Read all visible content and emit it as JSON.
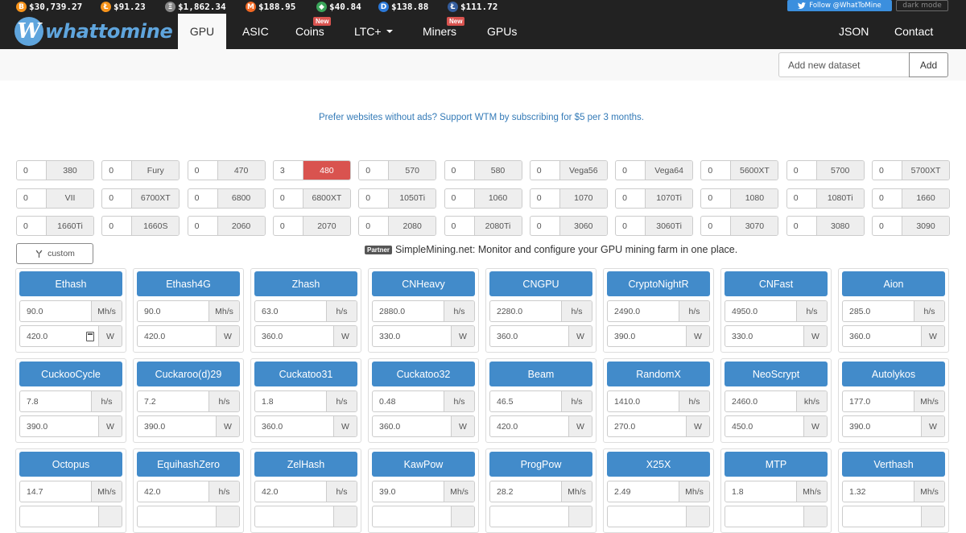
{
  "ticker": [
    {
      "symbol": "B",
      "price": "$30,739.27",
      "color": "#f7931a"
    },
    {
      "symbol": "Ł",
      "price": "$91.23",
      "color": "#f7931a"
    },
    {
      "symbol": "Ξ",
      "price": "$1,862.34",
      "color": "#888888"
    },
    {
      "symbol": "M",
      "price": "$188.95",
      "color": "#f26822"
    },
    {
      "symbol": "◆",
      "price": "$40.84",
      "color": "#3aa55a"
    },
    {
      "symbol": "D",
      "price": "$138.88",
      "color": "#2a78d8"
    },
    {
      "symbol": "Ł",
      "price": "$111.72",
      "color": "#345d9d"
    }
  ],
  "follow_label": "Follow @WhatToMine",
  "dark_mode_label": "dark mode",
  "brand": "whattomine",
  "brand_letter": "W",
  "nav": {
    "gpu": "GPU",
    "asic": "ASIC",
    "coins": "Coins",
    "ltc": "LTC+",
    "miners": "Miners",
    "gpus": "GPUs",
    "json": "JSON",
    "contact": "Contact",
    "new_badge": "New"
  },
  "dataset": {
    "placeholder": "Add new dataset",
    "add_label": "Add"
  },
  "promo": "Prefer websites without ads? Support WTM by subscribing for $5 per 3 months.",
  "gpus": [
    {
      "count": "0",
      "name": "380"
    },
    {
      "count": "0",
      "name": "Fury"
    },
    {
      "count": "0",
      "name": "470"
    },
    {
      "count": "3",
      "name": "480",
      "selected": true
    },
    {
      "count": "0",
      "name": "570"
    },
    {
      "count": "0",
      "name": "580"
    },
    {
      "count": "0",
      "name": "Vega56"
    },
    {
      "count": "0",
      "name": "Vega64"
    },
    {
      "count": "0",
      "name": "5600XT"
    },
    {
      "count": "0",
      "name": "5700"
    },
    {
      "count": "0",
      "name": "5700XT"
    },
    {
      "count": "0",
      "name": "VII"
    },
    {
      "count": "0",
      "name": "6700XT"
    },
    {
      "count": "0",
      "name": "6800"
    },
    {
      "count": "0",
      "name": "6800XT"
    },
    {
      "count": "0",
      "name": "1050Ti"
    },
    {
      "count": "0",
      "name": "1060"
    },
    {
      "count": "0",
      "name": "1070"
    },
    {
      "count": "0",
      "name": "1070Ti"
    },
    {
      "count": "0",
      "name": "1080"
    },
    {
      "count": "0",
      "name": "1080Ti"
    },
    {
      "count": "0",
      "name": "1660"
    },
    {
      "count": "0",
      "name": "1660Ti"
    },
    {
      "count": "0",
      "name": "1660S"
    },
    {
      "count": "0",
      "name": "2060"
    },
    {
      "count": "0",
      "name": "2070"
    },
    {
      "count": "0",
      "name": "2080"
    },
    {
      "count": "0",
      "name": "2080Ti"
    },
    {
      "count": "0",
      "name": "3060"
    },
    {
      "count": "0",
      "name": "3060Ti"
    },
    {
      "count": "0",
      "name": "3070"
    },
    {
      "count": "0",
      "name": "3080"
    },
    {
      "count": "0",
      "name": "3090"
    }
  ],
  "custom_label": "custom",
  "partner": {
    "badge": "Partner",
    "text": "SimpleMining.net: Monitor and configure your GPU mining farm in one place."
  },
  "algos": [
    {
      "name": "Ethash",
      "hashrate": "90.0",
      "unit": "Mh/s",
      "power": "420.0",
      "power_unit": "W"
    },
    {
      "name": "Ethash4G",
      "hashrate": "90.0",
      "unit": "Mh/s",
      "power": "420.0",
      "power_unit": "W"
    },
    {
      "name": "Zhash",
      "hashrate": "63.0",
      "unit": "h/s",
      "power": "360.0",
      "power_unit": "W"
    },
    {
      "name": "CNHeavy",
      "hashrate": "2880.0",
      "unit": "h/s",
      "power": "330.0",
      "power_unit": "W"
    },
    {
      "name": "CNGPU",
      "hashrate": "2280.0",
      "unit": "h/s",
      "power": "360.0",
      "power_unit": "W"
    },
    {
      "name": "CryptoNightR",
      "hashrate": "2490.0",
      "unit": "h/s",
      "power": "390.0",
      "power_unit": "W"
    },
    {
      "name": "CNFast",
      "hashrate": "4950.0",
      "unit": "h/s",
      "power": "330.0",
      "power_unit": "W"
    },
    {
      "name": "Aion",
      "hashrate": "285.0",
      "unit": "h/s",
      "power": "360.0",
      "power_unit": "W"
    },
    {
      "name": "CuckooCycle",
      "hashrate": "7.8",
      "unit": "h/s",
      "power": "390.0",
      "power_unit": "W"
    },
    {
      "name": "Cuckaroo(d)29",
      "hashrate": "7.2",
      "unit": "h/s",
      "power": "390.0",
      "power_unit": "W"
    },
    {
      "name": "Cuckatoo31",
      "hashrate": "1.8",
      "unit": "h/s",
      "power": "360.0",
      "power_unit": "W"
    },
    {
      "name": "Cuckatoo32",
      "hashrate": "0.48",
      "unit": "h/s",
      "power": "360.0",
      "power_unit": "W"
    },
    {
      "name": "Beam",
      "hashrate": "46.5",
      "unit": "h/s",
      "power": "420.0",
      "power_unit": "W"
    },
    {
      "name": "RandomX",
      "hashrate": "1410.0",
      "unit": "h/s",
      "power": "270.0",
      "power_unit": "W"
    },
    {
      "name": "NeoScrypt",
      "hashrate": "2460.0",
      "unit": "kh/s",
      "power": "450.0",
      "power_unit": "W"
    },
    {
      "name": "Autolykos",
      "hashrate": "177.0",
      "unit": "Mh/s",
      "power": "390.0",
      "power_unit": "W"
    },
    {
      "name": "Octopus",
      "hashrate": "14.7",
      "unit": "Mh/s",
      "power": "",
      "power_unit": ""
    },
    {
      "name": "EquihashZero",
      "hashrate": "42.0",
      "unit": "h/s",
      "power": "",
      "power_unit": ""
    },
    {
      "name": "ZelHash",
      "hashrate": "42.0",
      "unit": "h/s",
      "power": "",
      "power_unit": ""
    },
    {
      "name": "KawPow",
      "hashrate": "39.0",
      "unit": "Mh/s",
      "power": "",
      "power_unit": ""
    },
    {
      "name": "ProgPow",
      "hashrate": "28.2",
      "unit": "Mh/s",
      "power": "",
      "power_unit": ""
    },
    {
      "name": "X25X",
      "hashrate": "2.49",
      "unit": "Mh/s",
      "power": "",
      "power_unit": ""
    },
    {
      "name": "MTP",
      "hashrate": "1.8",
      "unit": "Mh/s",
      "power": "",
      "power_unit": ""
    },
    {
      "name": "Verthash",
      "hashrate": "1.32",
      "unit": "Mh/s",
      "power": "",
      "power_unit": ""
    }
  ]
}
